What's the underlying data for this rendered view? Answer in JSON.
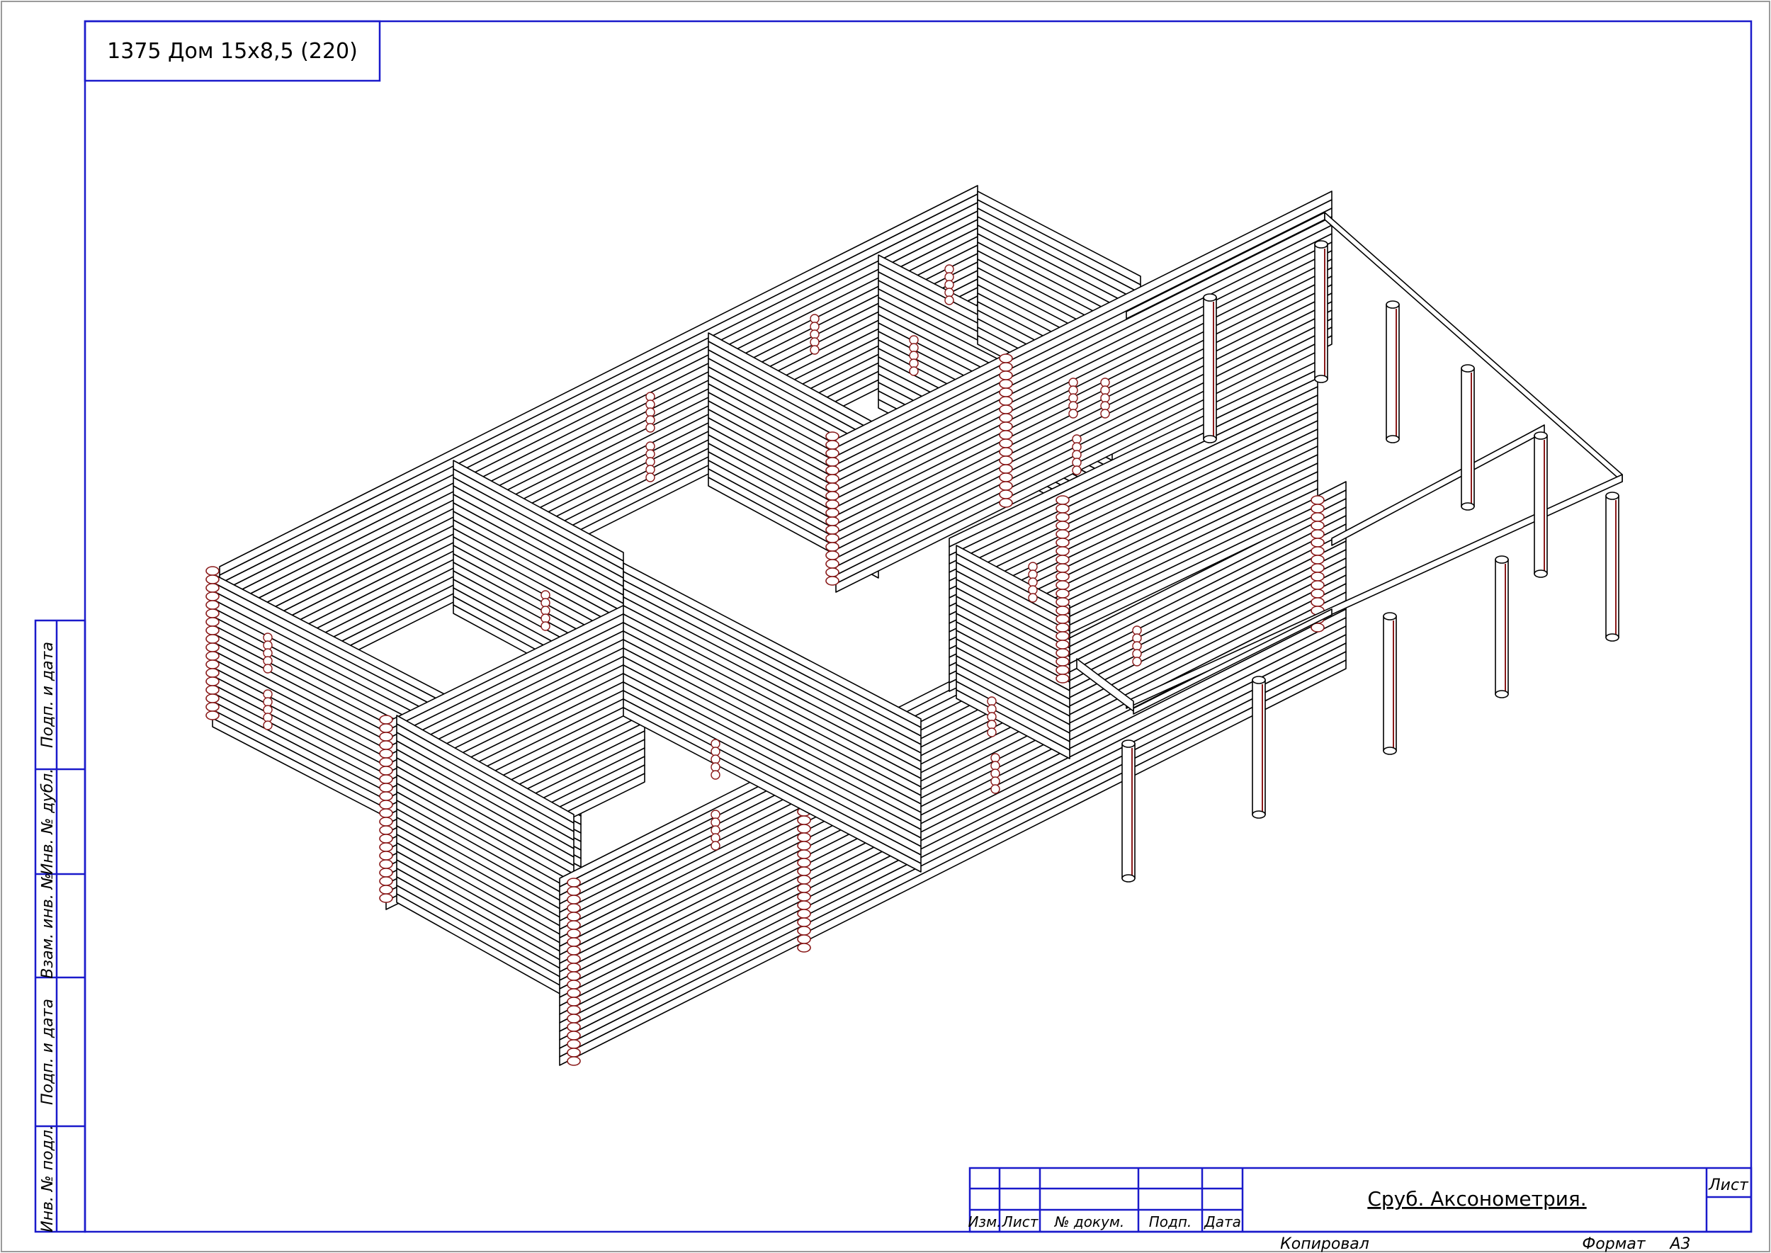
{
  "drawing": {
    "code_title": "1375 Дом 15x8,5 (220)",
    "sheet_name": "Сруб. Аксонометрия.",
    "sheet_label": "Лист",
    "copied_label": "Копировал",
    "format_label": "Формат",
    "format_value": "A3"
  },
  "title_block_headers": [
    "Изм.",
    "Лист",
    "№ докум.",
    "Подп.",
    "Дата"
  ],
  "side_stamp": [
    "Подп. и дата",
    "Инв. № дубл.",
    "Взам. инв. №",
    "Подп. и дата",
    "Инв. № подл."
  ],
  "colors": {
    "frame": "#1a1acb",
    "line": "#000000",
    "log_end": "#8a1a1a",
    "sheet_border": "#9a9a9a"
  }
}
